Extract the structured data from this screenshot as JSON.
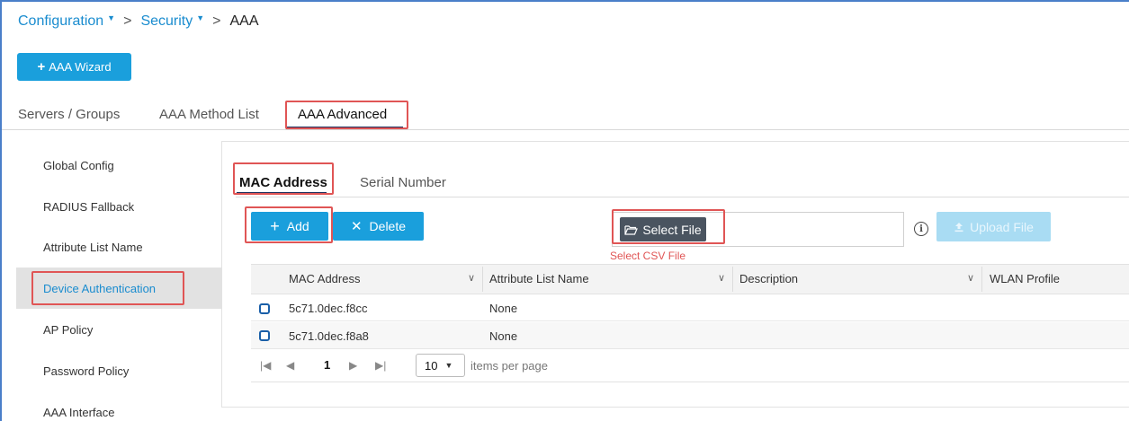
{
  "breadcrumb": {
    "items": [
      "Configuration",
      "Security",
      "AAA"
    ],
    "separator": ">"
  },
  "wizard_button": {
    "icon": "+",
    "label": "AAA Wizard"
  },
  "tabs": [
    {
      "label": "Servers / Groups"
    },
    {
      "label": "AAA Method List"
    },
    {
      "label": "AAA Advanced",
      "active": true
    }
  ],
  "sidebar": {
    "items": [
      {
        "label": "Global Config"
      },
      {
        "label": "RADIUS Fallback"
      },
      {
        "label": "Attribute List Name"
      },
      {
        "label": "Device Authentication",
        "active": true
      },
      {
        "label": "AP Policy"
      },
      {
        "label": "Password Policy"
      },
      {
        "label": "AAA Interface"
      }
    ]
  },
  "subtabs": [
    {
      "label": "MAC Address",
      "active": true
    },
    {
      "label": "Serial Number"
    }
  ],
  "toolbar": {
    "add_label": "Add",
    "delete_label": "Delete",
    "select_file_label": "Select File",
    "select_file_hint": "Select CSV File",
    "info_glyph": "i",
    "upload_label": "Upload File"
  },
  "table": {
    "columns": [
      "MAC Address",
      "Attribute List Name",
      "Description",
      "WLAN Profile"
    ],
    "rows": [
      [
        "5c71.0dec.f8cc",
        "None",
        "",
        ""
      ],
      [
        "5c71.0dec.f8a8",
        "None",
        "",
        ""
      ]
    ]
  },
  "pager": {
    "current_page": "1",
    "page_size": "10",
    "items_per_page_label": "items per page"
  },
  "colors": {
    "accent": "#1a9fdc",
    "highlight_box": "#e05555",
    "link": "#1a8ccf"
  }
}
